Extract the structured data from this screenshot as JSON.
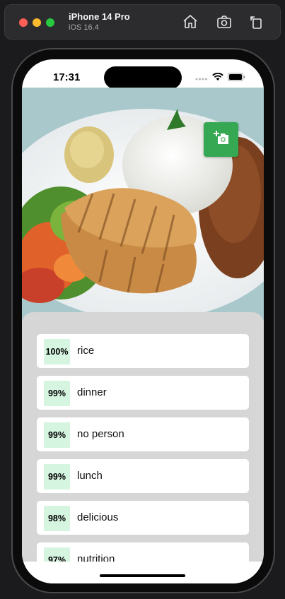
{
  "simulator": {
    "device_name": "iPhone 14 Pro",
    "os_version": "iOS 16.4",
    "icons": [
      "home-icon",
      "screenshot-icon",
      "rotate-icon"
    ]
  },
  "status_bar": {
    "time": "17:31",
    "icons": [
      "signal-dots-icon",
      "wifi-icon",
      "battery-icon"
    ]
  },
  "photo": {
    "description_icon": "food-photo",
    "camera_button_icon": "add-photo-icon",
    "accent_color": "#36a853"
  },
  "results": [
    {
      "confidence": "100%",
      "label": "rice"
    },
    {
      "confidence": "99%",
      "label": "dinner"
    },
    {
      "confidence": "99%",
      "label": "no person"
    },
    {
      "confidence": "99%",
      "label": "lunch"
    },
    {
      "confidence": "98%",
      "label": "delicious"
    },
    {
      "confidence": "97%",
      "label": "nutrition"
    }
  ],
  "colors": {
    "badge_bg": "#d6f5e1",
    "panel_bg": "#d6d6d6"
  }
}
